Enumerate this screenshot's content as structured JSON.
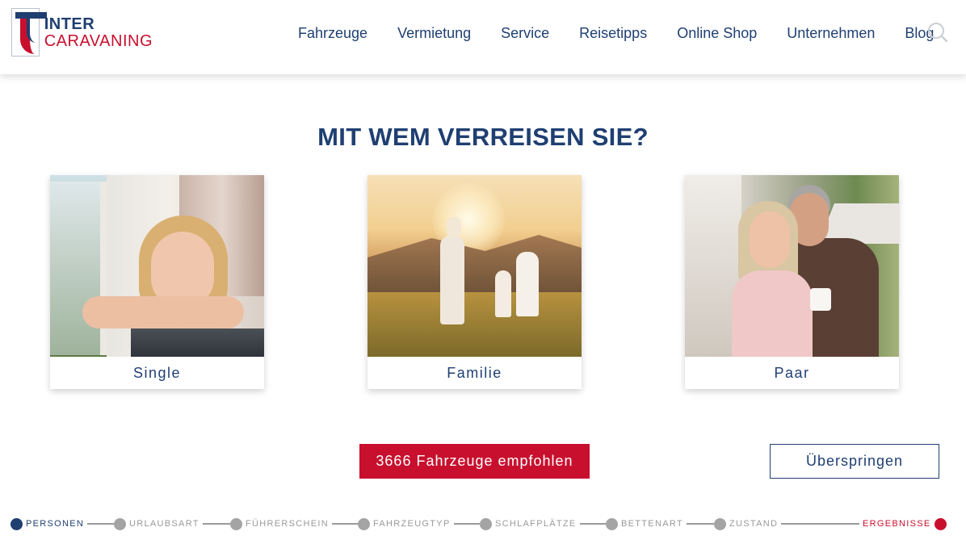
{
  "brand": {
    "line1": "INTER",
    "line2": "CARAVANING"
  },
  "nav": {
    "items": [
      "Fahrzeuge",
      "Vermietung",
      "Service",
      "Reisetipps",
      "Online Shop",
      "Unternehmen",
      "Blog"
    ]
  },
  "question": {
    "title": "MIT WEM VERREISEN SIE?"
  },
  "cards": [
    {
      "label": "Single"
    },
    {
      "label": "Familie"
    },
    {
      "label": "Paar"
    }
  ],
  "actions": {
    "recommend": "3666 Fahrzeuge empfohlen",
    "skip": "Überspringen"
  },
  "progress": {
    "steps": [
      "PERSONEN",
      "URLAUBSART",
      "FÜHRERSCHEIN",
      "FAHRZEUGTYP",
      "SCHLAFPLÄTZE",
      "BETTENART",
      "ZUSTAND",
      "ERGEBNISSE"
    ],
    "current": "PERSONEN"
  },
  "colors": {
    "primary": "#1f3f72",
    "accent": "#c8102e",
    "inactive": "#a4a4a4"
  },
  "icons": {
    "search": "search-icon",
    "logo": "logo-icon"
  }
}
